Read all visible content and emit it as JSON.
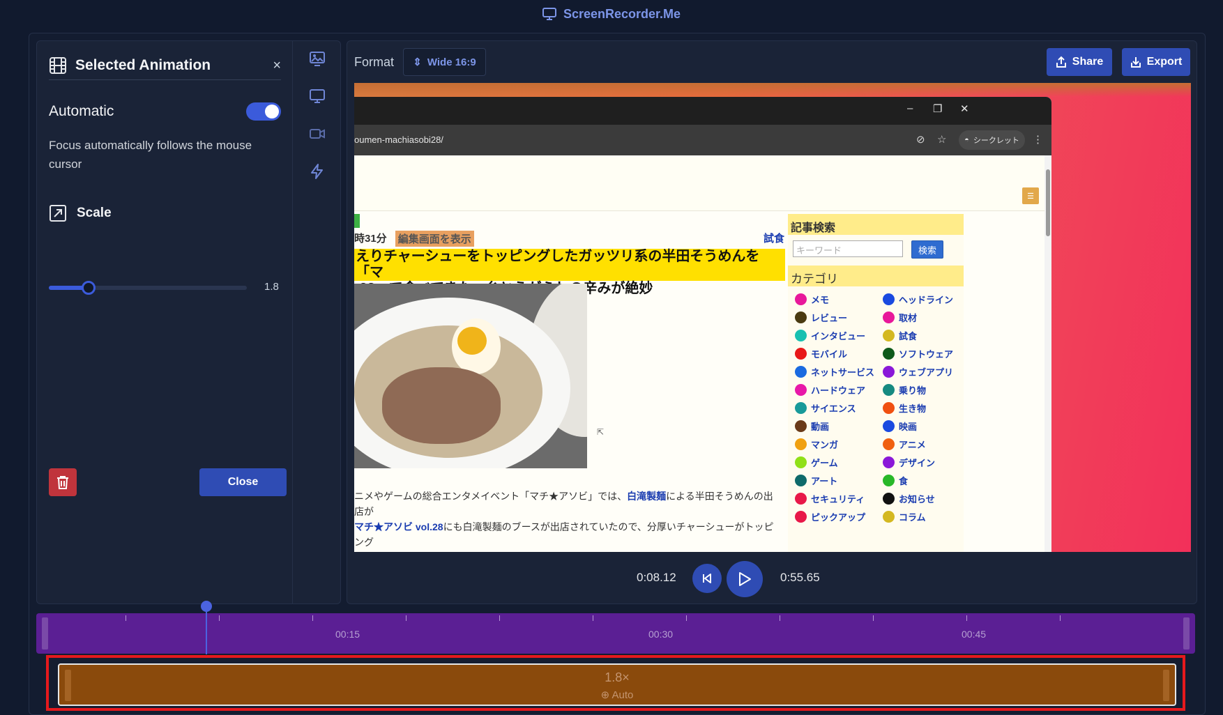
{
  "app": {
    "title": "ScreenRecorder.Me"
  },
  "panel": {
    "title": "Selected Animation",
    "close_symbol": "×",
    "automatic_label": "Automatic",
    "automatic_on": true,
    "description": "Focus automatically follows the mouse cursor",
    "scale_label": "Scale",
    "scale_value": "1.8",
    "scale_slider_fraction": 0.2,
    "close_button": "Close"
  },
  "rail": {
    "icons": [
      "image-icon",
      "monitor-icon",
      "video-camera-icon",
      "lightning-icon"
    ]
  },
  "toolbar": {
    "format_label": "Format",
    "format_value": "Wide 16:9",
    "share_label": "Share",
    "export_label": "Export"
  },
  "browser": {
    "url": "oumen-machiasobi28/",
    "incognito_label": "シークレット",
    "meta_time": "時31分",
    "meta_edit": "編集画面を表示",
    "category_link": "試食",
    "headline_line1": "えりチャーシューをトッピングしたガッツリ系の半田そうめんを「マ",
    "headline_line2": ".28」で食べてきた、糸とうがらしの辛みが絶妙",
    "body_line1_pre": "ニメやゲームの総合エンタメイベント「マチ★アソビ」では、",
    "body_line1_link": "白滝製麺",
    "body_line1_post": "による半田そうめんの出店が",
    "body_line2_link": "マチ★アソビ vol.28",
    "body_line2_post": "にも白滝製麺のブースが出店されていたので、分厚いチャーシューがトッピング",
    "search_heading": "記事検索",
    "search_placeholder": "キーワード",
    "search_button": "検索",
    "category_heading": "カテゴリ",
    "categories": [
      {
        "label": "メモ",
        "color": "#e8189a"
      },
      {
        "label": "ヘッドライン",
        "color": "#1a4ae0"
      },
      {
        "label": "レビュー",
        "color": "#4a3a10"
      },
      {
        "label": "取材",
        "color": "#e8189a"
      },
      {
        "label": "インタビュー",
        "color": "#18c0b0"
      },
      {
        "label": "試食",
        "color": "#d4b820"
      },
      {
        "label": "モバイル",
        "color": "#e81818"
      },
      {
        "label": "ソフトウェア",
        "color": "#0e5a1a"
      },
      {
        "label": "ネットサービス",
        "color": "#1a6ae0"
      },
      {
        "label": "ウェブアプリ",
        "color": "#8a18d8"
      },
      {
        "label": "ハードウェア",
        "color": "#e818a8"
      },
      {
        "label": "乗り物",
        "color": "#168a80"
      },
      {
        "label": "サイエンス",
        "color": "#189a9a"
      },
      {
        "label": "生き物",
        "color": "#f05010"
      },
      {
        "label": "動画",
        "color": "#6a3a18"
      },
      {
        "label": "映画",
        "color": "#1a4ae0"
      },
      {
        "label": "マンガ",
        "color": "#f0a010"
      },
      {
        "label": "アニメ",
        "color": "#f06010"
      },
      {
        "label": "ゲーム",
        "color": "#90e018"
      },
      {
        "label": "デザイン",
        "color": "#8a18d8"
      },
      {
        "label": "アート",
        "color": "#0e6a6a"
      },
      {
        "label": "食",
        "color": "#28b828"
      },
      {
        "label": "セキュリティ",
        "color": "#e81848"
      },
      {
        "label": "お知らせ",
        "color": "#111111"
      },
      {
        "label": "ピックアップ",
        "color": "#e81848"
      },
      {
        "label": "コラム",
        "color": "#d4b820"
      }
    ]
  },
  "playback": {
    "current_time": "0:08.12",
    "total_time": "0:55.65"
  },
  "timeline": {
    "labels": [
      "00:15",
      "00:30",
      "00:45"
    ],
    "clip_scale": "1.8×",
    "clip_mode": "Auto"
  }
}
